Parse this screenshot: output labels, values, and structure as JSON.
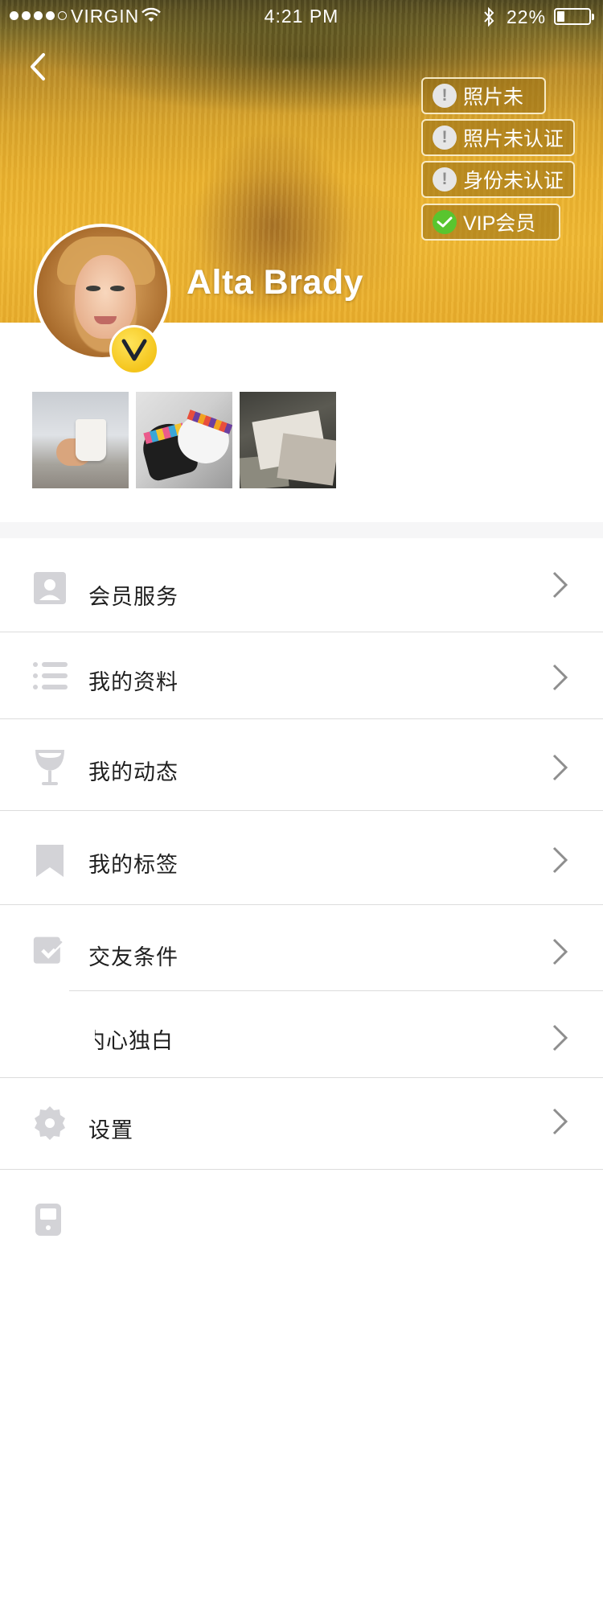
{
  "status_bar": {
    "carrier": "VIRGIN",
    "time": "4:21 PM",
    "battery": "22%",
    "battery_level": 0.22,
    "signal_dots": 5,
    "signal_filled": 4
  },
  "profile": {
    "name": "Alta Brady",
    "badges": [
      {
        "label": "照片未",
        "status": "warning",
        "icon": "exclamation-icon"
      },
      {
        "label": "照片未认证",
        "status": "warning",
        "icon": "exclamation-icon"
      },
      {
        "label": "身份未认证",
        "status": "warning",
        "icon": "exclamation-icon"
      },
      {
        "label": "VIP会员",
        "status": "verified",
        "icon": "checkmark-icon"
      }
    ],
    "vip_letter": "V",
    "photos_count": 3
  },
  "menu": [
    {
      "label": "会员服务",
      "icon": "member-contact-icon"
    },
    {
      "label": "我的资料",
      "icon": "list-icon"
    },
    {
      "label": "我的动态",
      "icon": "wine-glass-icon"
    },
    {
      "label": "我的标签",
      "icon": "bookmark-icon"
    },
    {
      "label": "交友条件",
      "icon": "checkbox-icon"
    },
    {
      "label": "内心独白",
      "icon": ""
    },
    {
      "label": "设置",
      "icon": "gear-icon"
    },
    {
      "label": "",
      "icon": "phone-icon"
    }
  ],
  "colors": {
    "accent_yellow": "#f4c51c",
    "verified_green": "#59c52f",
    "icon_gray": "#d3d3d7",
    "chevron_gray": "#8e8e8e"
  }
}
